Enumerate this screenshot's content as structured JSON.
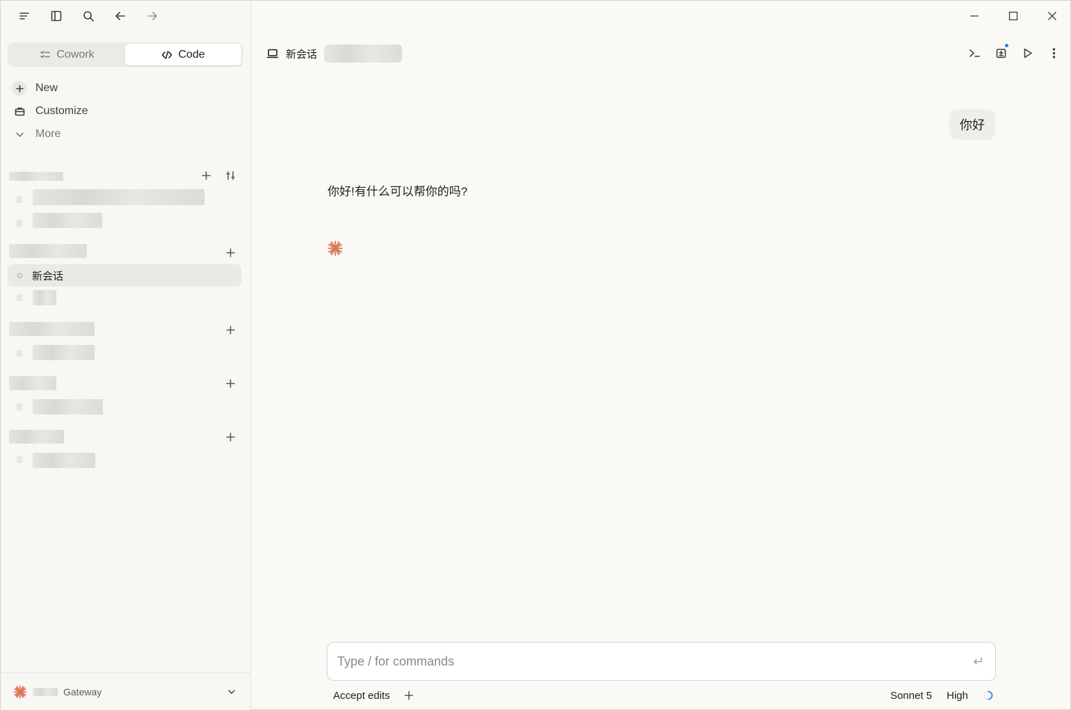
{
  "modes": {
    "cowork": "Cowork",
    "code": "Code",
    "active": "code"
  },
  "nav": {
    "new": "New",
    "customize": "Customize",
    "more": "More"
  },
  "sessions": {
    "active_title": "新会话"
  },
  "footer": {
    "label": "Gateway"
  },
  "header": {
    "title": "新会话"
  },
  "conversation": {
    "user": "你好",
    "assistant": "你好!有什么可以帮你的吗?"
  },
  "composer": {
    "placeholder": "Type / for commands",
    "mode": "Accept edits",
    "model": "Sonnet 5",
    "effort": "High"
  },
  "colors": {
    "accent": "#d97757",
    "notify": "#2f7ae5",
    "spinner": "#3b82f6"
  }
}
